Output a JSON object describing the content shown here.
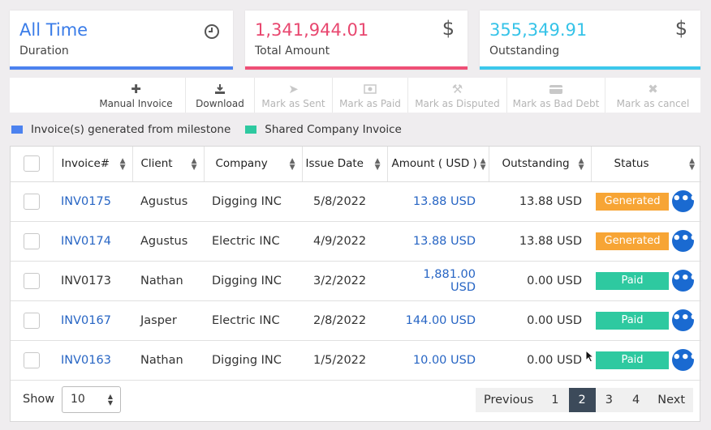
{
  "cards": [
    {
      "value": "All Time",
      "label": "Duration",
      "icon": "clock-icon",
      "value_color": "#3a7ce8",
      "bar_color": "#4c82ef"
    },
    {
      "value": "1,341,944.01",
      "label": "Total Amount",
      "icon": "dollar-icon",
      "value_color": "#e8476f",
      "bar_color": "#ef4f76"
    },
    {
      "value": "355,349.91",
      "label": "Outstanding",
      "icon": "dollar-icon",
      "value_color": "#36c3e8",
      "bar_color": "#3cc8ec"
    }
  ],
  "toolbar": {
    "manual_invoice": "Manual Invoice",
    "download": "Download",
    "mark_sent": "Mark as Sent",
    "mark_paid": "Mark as Paid",
    "mark_disputed": "Mark as Disputed",
    "mark_bad_debt": "Mark as Bad Debt",
    "mark_cancel": "Mark as cancel"
  },
  "legend": {
    "milestone": "Invoice(s) generated from milestone",
    "milestone_color": "#4c82ef",
    "shared": "Shared Company Invoice",
    "shared_color": "#2ec9a0"
  },
  "table": {
    "headers": {
      "invoice": "Invoice#",
      "client": "Client",
      "company": "Company",
      "issue_date": "Issue Date",
      "amount": "Amount ( USD )",
      "outstanding": "Outstanding",
      "status": "Status"
    },
    "rows": [
      {
        "invoice": "INV0175",
        "client": "Agustus",
        "company": "Digging INC",
        "date": "5/8/2022",
        "amount": "13.88 USD",
        "outstanding": "13.88 USD",
        "status": "Generated"
      },
      {
        "invoice": "INV0174",
        "client": "Agustus",
        "company": "Electric INC",
        "date": "4/9/2022",
        "amount": "13.88 USD",
        "outstanding": "13.88 USD",
        "status": "Generated"
      },
      {
        "invoice": "INV0173",
        "client": "Nathan",
        "company": "Digging INC",
        "date": "3/2/2022",
        "amount": "1,881.00 USD",
        "outstanding": "0.00 USD",
        "status": "Paid"
      },
      {
        "invoice": "INV0167",
        "client": "Jasper",
        "company": "Electric INC",
        "date": "2/8/2022",
        "amount": "144.00 USD",
        "outstanding": "0.00 USD",
        "status": "Paid"
      },
      {
        "invoice": "INV0163",
        "client": "Nathan",
        "company": "Digging INC",
        "date": "1/5/2022",
        "amount": "10.00 USD",
        "outstanding": "0.00 USD",
        "status": "Paid"
      }
    ],
    "status_colors": {
      "Generated": "#f7a535",
      "Paid": "#2ec9a0"
    }
  },
  "footer": {
    "show_label": "Show",
    "page_size": "10",
    "previous": "Previous",
    "pages": [
      "1",
      "2",
      "3",
      "4"
    ],
    "active_page": "2",
    "next": "Next"
  }
}
